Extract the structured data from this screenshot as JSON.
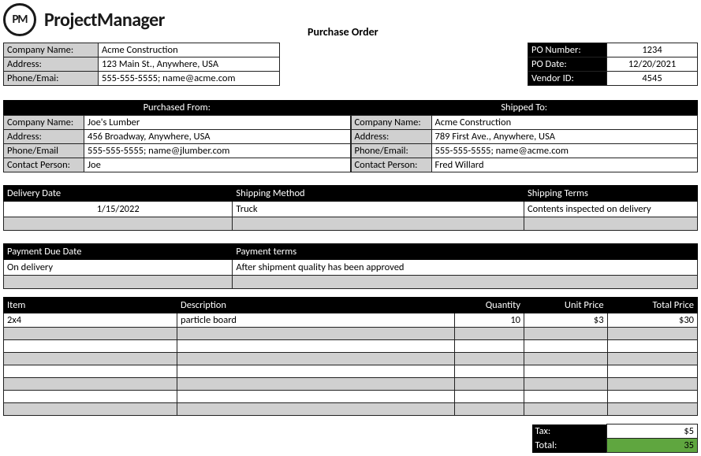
{
  "brand": {
    "logo_text": "PM",
    "name": "ProjectManager"
  },
  "doc_title": "Purchase Order",
  "company": {
    "labels": {
      "name": "Company Name:",
      "address": "Address:",
      "phone": "Phone/Emai:"
    },
    "name": "Acme Construction",
    "address": "123 Main St., Anywhere, USA",
    "phone": "555-555-5555; name@acme.com"
  },
  "po": {
    "labels": {
      "number": "PO Number:",
      "date": "PO Date:",
      "vendor": "Vendor ID:"
    },
    "number": "1234",
    "date": "12/20/2021",
    "vendor": "4545"
  },
  "purchased_from": {
    "title": "Purchased From:",
    "labels": {
      "name": "Company Name:",
      "address": "Address:",
      "phone": "Phone/Email",
      "contact": "Contact Person:"
    },
    "name": "Joe's Lumber",
    "address": "456 Broadway, Anywhere, USA",
    "phone": "555-555-5555; name@jlumber.com",
    "contact": "Joe"
  },
  "shipped_to": {
    "title": "Shipped To:",
    "labels": {
      "name": "Company Name:",
      "address": "Address:",
      "phone": "Phone/Email:",
      "contact": "Contact Person:"
    },
    "name": "Acme Construction",
    "address": "789 First Ave., Anywhere, USA",
    "phone": "555-555-5555; name@acme.com",
    "contact": "Fred Willard"
  },
  "shipping": {
    "headers": {
      "date": "Delivery Date",
      "method": "Shipping Method",
      "terms": "Shipping Terms"
    },
    "date": "1/15/2022",
    "method": "Truck",
    "terms": "Contents inspected on delivery"
  },
  "payment": {
    "headers": {
      "due": "Payment Due Date",
      "terms": "Payment terms"
    },
    "due": "On delivery",
    "terms": "After shipment quality has been approved"
  },
  "items": {
    "headers": {
      "item": "Item",
      "desc": "Description",
      "qty": "Quantity",
      "unit": "Unit Price",
      "total": "Total Price"
    },
    "rows": [
      {
        "item": "2x4",
        "desc": "particle board",
        "qty": "10",
        "unit": "$3",
        "total": "$30"
      },
      {
        "item": "",
        "desc": "",
        "qty": "",
        "unit": "",
        "total": ""
      },
      {
        "item": "",
        "desc": "",
        "qty": "",
        "unit": "",
        "total": ""
      },
      {
        "item": "",
        "desc": "",
        "qty": "",
        "unit": "",
        "total": ""
      },
      {
        "item": "",
        "desc": "",
        "qty": "",
        "unit": "",
        "total": ""
      },
      {
        "item": "",
        "desc": "",
        "qty": "",
        "unit": "",
        "total": ""
      },
      {
        "item": "",
        "desc": "",
        "qty": "",
        "unit": "",
        "total": ""
      },
      {
        "item": "",
        "desc": "",
        "qty": "",
        "unit": "",
        "total": ""
      }
    ]
  },
  "totals": {
    "tax_label": "Tax:",
    "tax_value": "$5",
    "total_label": "Total:",
    "total_value": "35"
  }
}
